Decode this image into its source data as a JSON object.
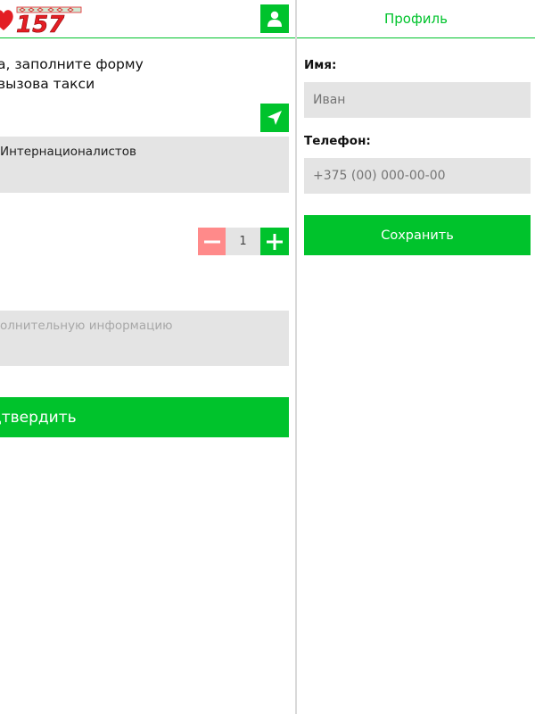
{
  "app": {
    "logo_number": "157",
    "brand_colors": {
      "green": "#00c32c",
      "red": "#e31e24",
      "minus_pink": "#ff8a8a"
    }
  },
  "order_form": {
    "intro_line1": "а, заполните форму",
    "intro_line2": "вызова такси",
    "address_value": "Интернационалистов",
    "passenger_count": "1",
    "comment_placeholder": "олнительную информацию",
    "confirm_label": "дтвердить",
    "icons": {
      "profile": "user-icon",
      "geolocate": "navigation-arrow-icon",
      "decrease": "minus-icon",
      "increase": "plus-icon"
    }
  },
  "profile": {
    "title": "Профиль",
    "name_label": "Имя:",
    "name_placeholder": "Иван",
    "phone_label": "Телефон:",
    "phone_placeholder": "+375 (00) 000-00-00",
    "save_label": "Сохранить"
  }
}
